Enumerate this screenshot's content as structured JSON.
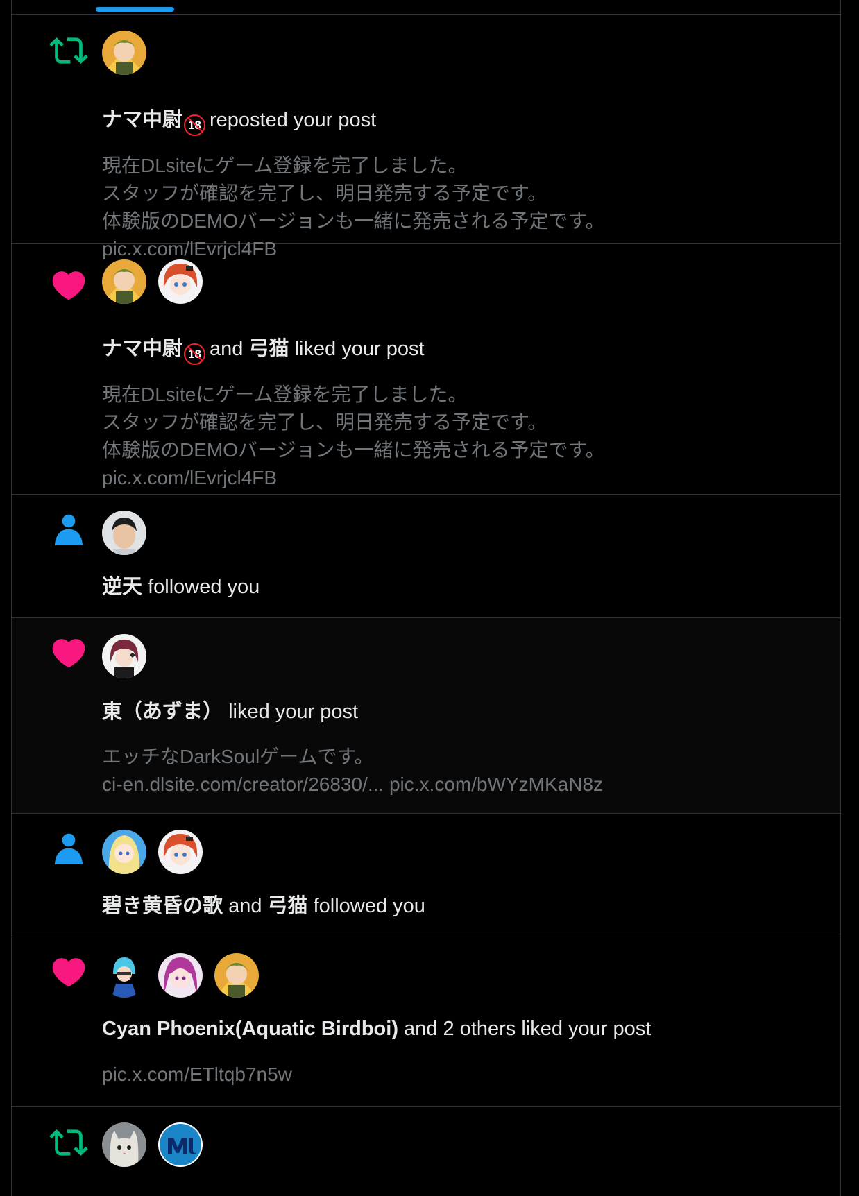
{
  "colors": {
    "repost": "#00ba7c",
    "like": "#f91880",
    "follow": "#1d9bf0",
    "badge": "#f4212e"
  },
  "notifications": [
    {
      "type": "repost",
      "icon": "repost-icon",
      "actor": "ナマ中尉",
      "badge": "18",
      "action": "reposted your post",
      "excerpt": [
        "現在DLsiteにゲーム登録を完了しました。",
        "スタッフが確認を完了し、明日発売する予定です。",
        "体験版のDEMOバージョンも一緒に発売される予定です。",
        "pic.x.com/lEvrjcl4FB"
      ]
    },
    {
      "type": "like",
      "icon": "heart-icon",
      "actor": "ナマ中尉",
      "badge": "18",
      "and": "and",
      "actor2": "弓猫",
      "action": "liked your post",
      "excerpt": [
        "現在DLsiteにゲーム登録を完了しました。",
        "スタッフが確認を完了し、明日発売する予定です。",
        "体験版のDEMOバージョンも一緒に発売される予定です。",
        "pic.x.com/lEvrjcl4FB"
      ]
    },
    {
      "type": "follow",
      "icon": "person-icon",
      "actor": "逆天",
      "action": "followed you"
    },
    {
      "type": "like",
      "icon": "heart-icon",
      "actor": "東（あずま）",
      "action": "liked your post",
      "excerpt": [
        "エッチなDarkSoulゲームです。",
        "ci-en.dlsite.com/creator/26830/... pic.x.com/bWYzMKaN8z"
      ]
    },
    {
      "type": "follow",
      "icon": "person-icon",
      "actor": "碧き黄昏の歌",
      "and": "and",
      "actor2": "弓猫",
      "action": "followed you"
    },
    {
      "type": "like",
      "icon": "heart-icon",
      "actor": "Cyan Phoenix(Aquatic Birdboi)",
      "action": "and 2 others liked your post",
      "excerpt": [
        "pic.x.com/ETltqb7n5w"
      ]
    },
    {
      "type": "repost",
      "icon": "repost-icon"
    }
  ]
}
